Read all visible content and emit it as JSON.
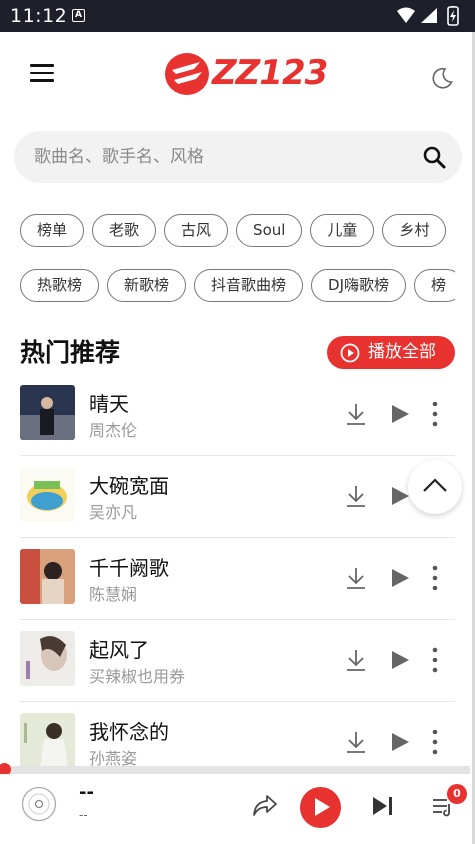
{
  "status_bar": {
    "time": "11:12",
    "app_icon_letter": "A"
  },
  "header": {
    "logo_text": "ZZ123",
    "menu_icon": "hamburger-menu-icon",
    "theme_icon": "moon-icon"
  },
  "search": {
    "placeholder": "歌曲名、歌手名、风格",
    "value": ""
  },
  "chip_rows": [
    [
      "榜单",
      "老歌",
      "古风",
      "Soul",
      "儿童",
      "乡村"
    ],
    [
      "热歌榜",
      "新歌榜",
      "抖音歌曲榜",
      "DJ嗨歌榜",
      "榜"
    ]
  ],
  "section": {
    "title": "热门推荐",
    "play_all_label": "播放全部"
  },
  "songs": [
    {
      "title": "晴天",
      "artist": "周杰伦"
    },
    {
      "title": "大碗宽面",
      "artist": "吴亦凡"
    },
    {
      "title": "千千阙歌",
      "artist": "陈慧娴"
    },
    {
      "title": "起风了",
      "artist": "买辣椒也用券"
    },
    {
      "title": "我怀念的",
      "artist": "孙燕姿"
    }
  ],
  "player": {
    "title": "--",
    "artist": "--",
    "queue_count": "0"
  },
  "colors": {
    "accent": "#e8322f",
    "status_bar": "#1f1f2b",
    "search_bg": "#f2f2f2"
  }
}
